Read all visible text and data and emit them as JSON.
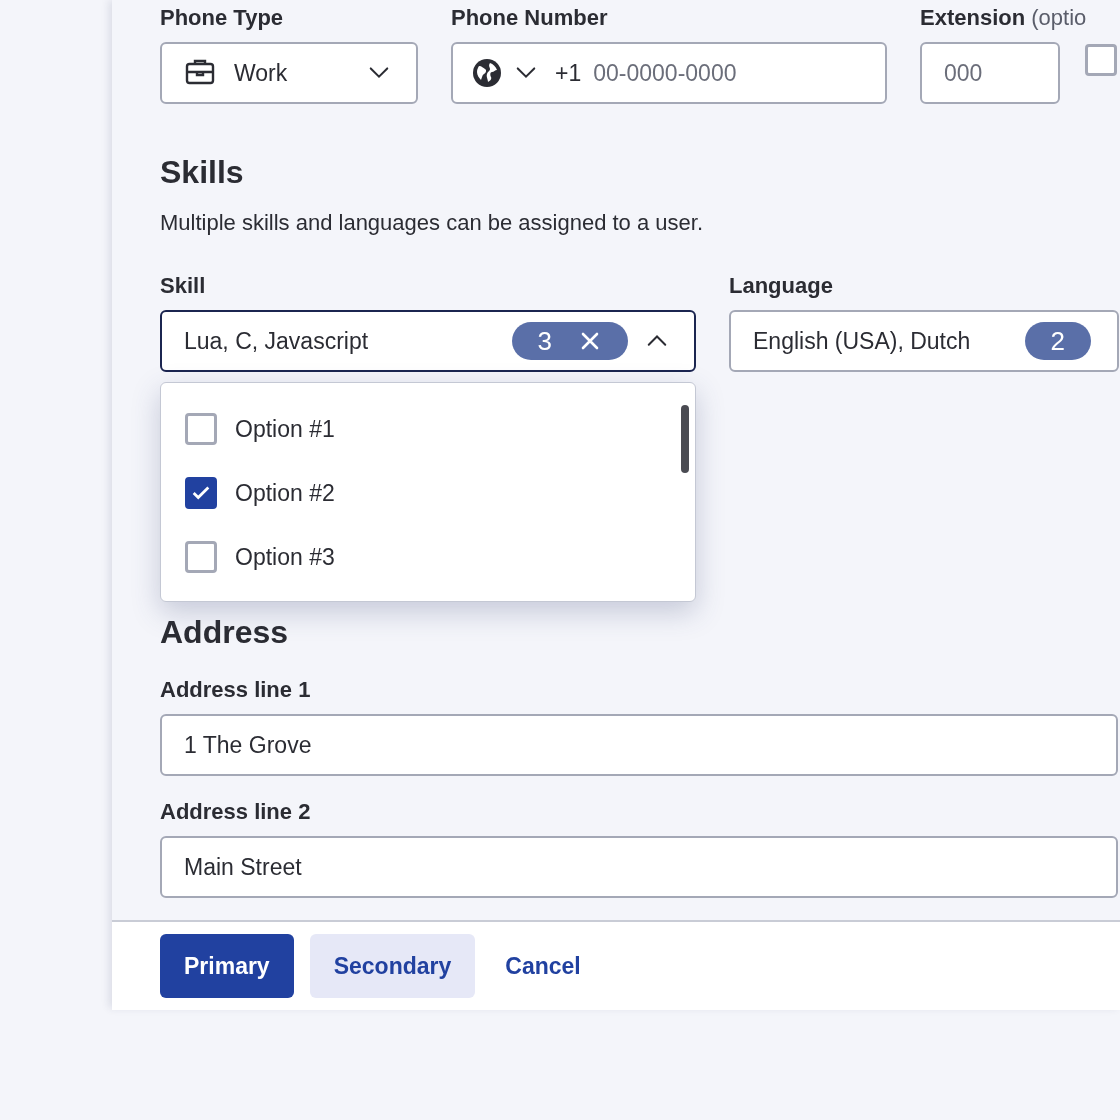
{
  "phone": {
    "type": {
      "label": "Phone Type",
      "value": "Work"
    },
    "number": {
      "label": "Phone Number",
      "prefix": "+1",
      "placeholder": "00-0000-0000"
    },
    "extension": {
      "label": "Extension",
      "hint": "(optio",
      "placeholder": "000"
    },
    "checkbox": {
      "checked": false
    }
  },
  "skills": {
    "title": "Skills",
    "description": "Multiple skills and languages can be assigned to a user.",
    "skill": {
      "label": "Skill",
      "value": "Lua, C, Javascript",
      "count": "3",
      "expanded": true,
      "options": [
        {
          "label": "Option #1",
          "checked": false
        },
        {
          "label": "Option #2",
          "checked": true
        },
        {
          "label": "Option #3",
          "checked": false
        }
      ]
    },
    "language": {
      "label": "Language",
      "value": "English (USA), Dutch",
      "count": "2"
    }
  },
  "address": {
    "title": "Address",
    "fields": [
      {
        "label": "Address line 1",
        "value": "1 The Grove"
      },
      {
        "label": "Address line 2",
        "value": "Main Street"
      }
    ]
  },
  "footer": {
    "buttons": [
      {
        "label": "Primary",
        "kind": "primary"
      },
      {
        "label": "Secondary",
        "kind": "secondary"
      },
      {
        "label": "Cancel",
        "kind": "link"
      }
    ]
  }
}
